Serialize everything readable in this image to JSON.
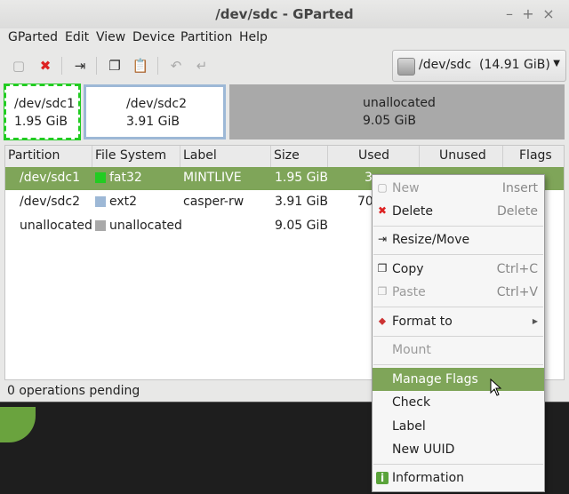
{
  "window": {
    "title": "/dev/sdc - GParted"
  },
  "menubar": [
    "GParted",
    "Edit",
    "View",
    "Device",
    "Partition",
    "Help"
  ],
  "device_selector": {
    "name": "/dev/sdc",
    "size": "(14.91 GiB)"
  },
  "partition_map": [
    {
      "name": "/dev/sdc1",
      "size": "1.95 GiB"
    },
    {
      "name": "/dev/sdc2",
      "size": "3.91 GiB"
    },
    {
      "name": "unallocated",
      "size": "9.05 GiB"
    }
  ],
  "table": {
    "headers": [
      "Partition",
      "File System",
      "Label",
      "Size",
      "Used",
      "Unused",
      "Flags"
    ],
    "rows": [
      {
        "partition": "/dev/sdc1",
        "fs": "fat32",
        "fs_color": "#22cc22",
        "label": "MINTLIVE",
        "size": "1.95 GiB",
        "used": "3"
      },
      {
        "partition": "/dev/sdc2",
        "fs": "ext2",
        "fs_color": "#9db8d6",
        "label": "casper-rw",
        "size": "3.91 GiB",
        "used": "70"
      },
      {
        "partition": "unallocated",
        "fs": "unallocated",
        "fs_color": "#a9a9a9",
        "label": "",
        "size": "9.05 GiB",
        "used": ""
      }
    ]
  },
  "status": {
    "text": "0 operations pending"
  },
  "context_menu": {
    "new": {
      "label": "New",
      "shortcut": "Insert"
    },
    "delete": {
      "label": "Delete",
      "shortcut": "Delete"
    },
    "resize": {
      "label": "Resize/Move"
    },
    "copy": {
      "label": "Copy",
      "shortcut": "Ctrl+C"
    },
    "paste": {
      "label": "Paste",
      "shortcut": "Ctrl+V"
    },
    "format": {
      "label": "Format to"
    },
    "mount": {
      "label": "Mount"
    },
    "manage_flags": {
      "label": "Manage Flags"
    },
    "check": {
      "label": "Check"
    },
    "label": {
      "label": "Label"
    },
    "new_uuid": {
      "label": "New UUID"
    },
    "information": {
      "label": "Information"
    }
  },
  "colors": {
    "selection": "#7fa559",
    "fat32": "#22cc22",
    "ext2": "#9db8d6",
    "unallocated": "#a9a9a9"
  }
}
